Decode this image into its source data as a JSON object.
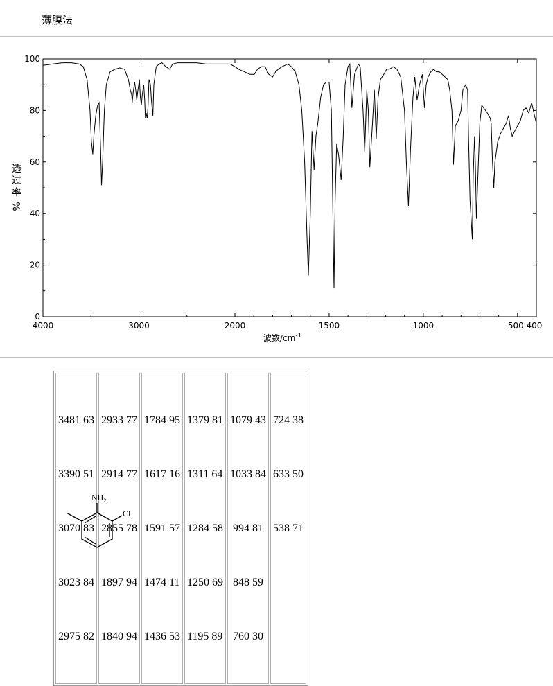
{
  "header": {
    "method": "薄膜法"
  },
  "chart_data": {
    "type": "line",
    "xlabel": "波数/cm",
    "xlabel_sup": "-1",
    "ylabel_chars": [
      "透",
      "过",
      "率",
      "%"
    ],
    "xlim": [
      4000,
      400
    ],
    "ylim": [
      0,
      100
    ],
    "x_breakpoint": 2000,
    "x_ticks_major": [
      4000,
      3000,
      2000,
      1500,
      1000,
      500
    ],
    "x_tick_labels": [
      {
        "v": 4000,
        "t": "4000"
      },
      {
        "v": 3000,
        "t": "3000"
      },
      {
        "v": 2000,
        "t": "2000"
      },
      {
        "v": 1500,
        "t": "1500"
      },
      {
        "v": 1000,
        "t": "1000"
      },
      {
        "v": 500,
        "t": "500 400"
      }
    ],
    "y_ticks": [
      0,
      20,
      40,
      60,
      80,
      100
    ],
    "y_tick_labels": [
      "0",
      "20",
      "40",
      "60",
      "80",
      "100"
    ],
    "series": [
      {
        "x": [
          4000,
          3900,
          3800,
          3700,
          3620,
          3580,
          3540,
          3510,
          3495,
          3481,
          3470,
          3450,
          3430,
          3415,
          3400,
          3390,
          3378,
          3360,
          3340,
          3300,
          3250,
          3200,
          3150,
          3110,
          3090,
          3075,
          3070,
          3060,
          3045,
          3030,
          3023,
          3010,
          2995,
          2985,
          2975,
          2965,
          2950,
          2940,
          2933,
          2925,
          2914,
          2905,
          2895,
          2880,
          2870,
          2860,
          2855,
          2845,
          2820,
          2790,
          2760,
          2720,
          2680,
          2650,
          2600,
          2550,
          2500,
          2400,
          2300,
          2200,
          2100,
          2050,
          2000,
          1980,
          1950,
          1920,
          1897,
          1880,
          1860,
          1840,
          1820,
          1800,
          1784,
          1770,
          1750,
          1720,
          1700,
          1680,
          1660,
          1645,
          1630,
          1617,
          1610,
          1600,
          1591,
          1580,
          1570,
          1560,
          1545,
          1530,
          1515,
          1500,
          1488,
          1480,
          1474,
          1468,
          1460,
          1450,
          1436,
          1425,
          1415,
          1400,
          1390,
          1379,
          1365,
          1345,
          1335,
          1320,
          1311,
          1300,
          1292,
          1284,
          1270,
          1260,
          1250,
          1240,
          1228,
          1210,
          1195,
          1180,
          1160,
          1140,
          1120,
          1100,
          1090,
          1079,
          1068,
          1055,
          1045,
          1033,
          1020,
          1005,
          994,
          985,
          975,
          960,
          945,
          930,
          915,
          900,
          885,
          870,
          860,
          848,
          840,
          830,
          815,
          800,
          790,
          775,
          765,
          760,
          752,
          740,
          735,
          728,
          724,
          718,
          710,
          700,
          690,
          680,
          660,
          645,
          640,
          633,
          626,
          620,
          605,
          590,
          575,
          560,
          548,
          538,
          528,
          515,
          500,
          485,
          470,
          455,
          440,
          425,
          410,
          400
        ],
        "y": [
          97.5,
          98,
          98.5,
          98.5,
          98,
          97,
          92,
          80,
          68,
          63,
          70,
          78,
          82,
          83,
          66,
          51,
          60,
          80,
          90,
          95,
          96,
          96.5,
          96,
          92,
          88,
          86,
          83,
          87,
          91,
          87,
          84,
          88,
          92,
          85,
          82,
          86,
          90,
          84,
          77,
          79,
          77,
          82,
          92,
          90,
          84,
          80,
          78,
          90,
          97,
          98,
          98.5,
          97,
          96,
          98,
          98.5,
          98.5,
          98.5,
          98.5,
          98,
          98,
          98,
          98,
          97,
          96,
          95,
          94,
          94,
          96,
          97,
          97,
          94,
          93,
          95,
          96,
          97,
          98,
          97,
          95,
          90,
          80,
          60,
          30,
          16,
          40,
          72,
          57,
          70,
          75,
          85,
          90,
          91,
          91,
          80,
          40,
          11,
          45,
          67,
          63,
          53,
          70,
          90,
          97,
          98,
          81,
          94,
          98,
          97,
          80,
          64,
          88,
          80,
          58,
          75,
          88,
          69,
          85,
          92,
          94,
          96,
          96,
          97,
          96,
          93,
          80,
          60,
          43,
          65,
          85,
          93,
          84,
          90,
          94,
          81,
          90,
          93,
          95,
          96,
          95,
          95,
          94,
          93,
          92,
          88,
          80,
          59,
          74,
          76,
          80,
          88,
          90,
          88,
          70,
          45,
          30,
          55,
          70,
          60,
          38,
          55,
          75,
          82,
          81,
          79,
          77,
          75,
          60,
          50,
          60,
          68,
          71,
          73,
          75,
          78,
          73,
          70,
          72,
          74,
          76,
          80,
          81,
          79,
          83,
          78,
          75
        ]
      }
    ]
  },
  "peak_table": [
    [
      "3481 63",
      "3390 51",
      "3070 83",
      "3023 84",
      "2975 82"
    ],
    [
      "2933 77",
      "2914 77",
      "2855 78",
      "1897 94",
      "1840 94"
    ],
    [
      "1784 95",
      "1617 16",
      "1591 57",
      "1474 11",
      "1436 53"
    ],
    [
      "1379 81",
      "1311 64",
      "1284 58",
      "1250 69",
      "1195 89"
    ],
    [
      "1079 43",
      "1033 84",
      " 994 81",
      " 848 59",
      " 760 30"
    ],
    [
      "724 38",
      "633 50",
      "538 71"
    ]
  ],
  "structure": {
    "amine_label": "NH",
    "amine_subscript": "2",
    "chloro_label": "Cl"
  }
}
